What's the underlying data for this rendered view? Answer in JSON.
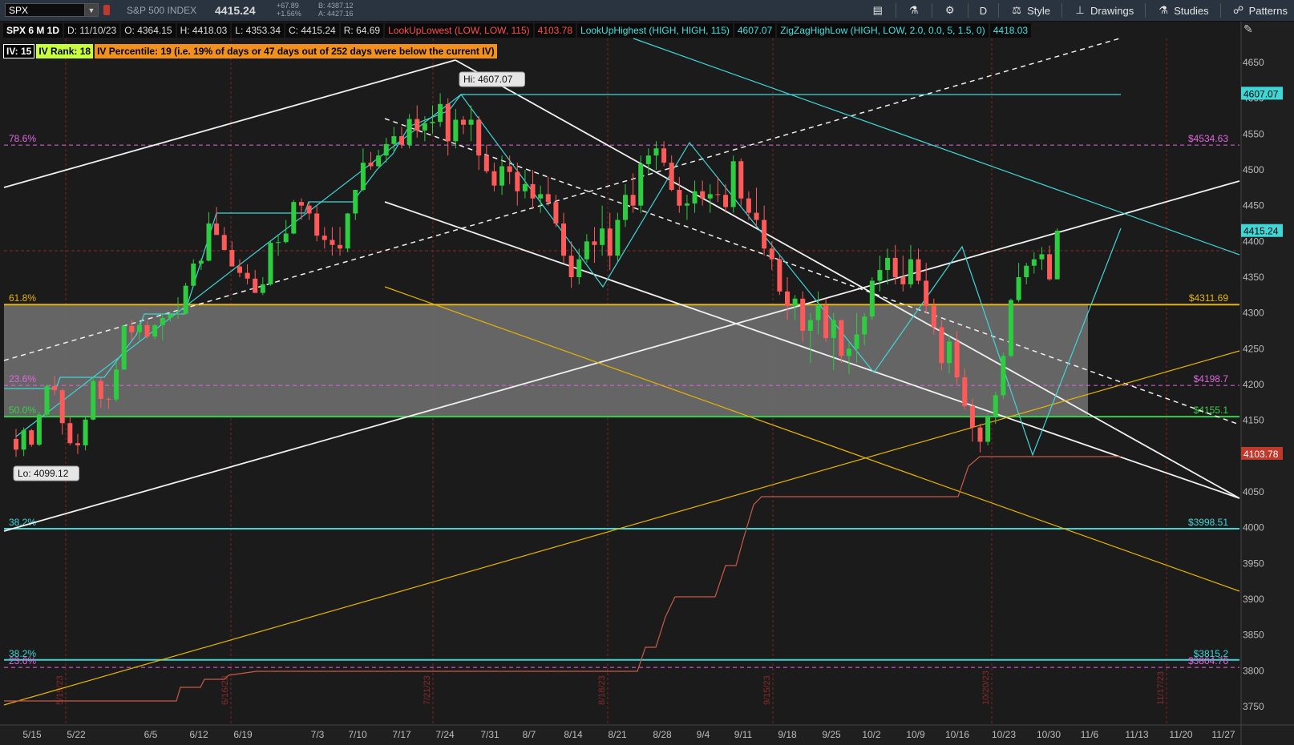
{
  "toolbar": {
    "symbol": "SPX",
    "name": "S&P 500 INDEX",
    "price": "4415.24",
    "change": "+67.89",
    "change_pct": "+1.56%",
    "bid": "B: 4387.12",
    "ask": "A: 4427.16",
    "period": "D",
    "style": "Style",
    "drawings": "Drawings",
    "studies": "Studies",
    "patterns": "Patterns"
  },
  "info": {
    "title": "SPX 6 M 1D",
    "date": "D: 11/10/23",
    "open": "O: 4364.15",
    "high": "H: 4418.03",
    "low": "L: 4353.34",
    "close": "C: 4415.24",
    "range": "R: 64.69",
    "study1": "LookUpLowest (LOW, LOW, 115)",
    "study1_val": "4103.78",
    "study2": "LookUpHighest (HIGH, HIGH, 115)",
    "study2_val": "4607.07",
    "study3": "ZigZagHighLow (HIGH, LOW, 2.0, 0.0, 5, 1.5, 0)",
    "study3_val": "4418.03"
  },
  "iv": {
    "iv": "IV: 15",
    "rank": "IV Rank: 18",
    "percentile": "IV Percentile: 19 (i.e. 19% of days or 47 days out of 252 days were below the current IV)"
  },
  "colors": {
    "up": "#2ecc40",
    "down": "#ff5a5a",
    "cyan": "#3fd6d6",
    "gold": "#e8b400",
    "green": "#36d14a",
    "magenta": "#e066e0",
    "white": "#f0f0f0",
    "lookup_low": "#c85a4a"
  },
  "chart_data": {
    "type": "candlestick",
    "title": "SPX 6 M 1D",
    "y_range": [
      3720,
      4680
    ],
    "y_ticks": [
      3750,
      3800,
      3850,
      3900,
      3950,
      4000,
      4050,
      4100,
      4150,
      4200,
      4250,
      4300,
      4350,
      4400,
      4450,
      4500,
      4550,
      4600,
      4650
    ],
    "x_ticks": [
      "5/15",
      "5/22",
      "6/5",
      "6/12",
      "6/19",
      "7/3",
      "7/10",
      "7/17",
      "7/24",
      "7/31",
      "8/7",
      "8/14",
      "8/21",
      "8/28",
      "9/4",
      "9/11",
      "9/18",
      "9/25",
      "10/2",
      "10/9",
      "10/16",
      "10/23",
      "10/30",
      "11/6",
      "11/13",
      "11/20",
      "11/27"
    ],
    "vertical_date_labels": [
      "5/19/23",
      "6/16/23",
      "7/21/23",
      "8/18/23",
      "9/15/23",
      "10/20/23",
      "11/17/23"
    ],
    "fib_levels": [
      {
        "label": "78.6%",
        "price": "$4534.63",
        "value": 4534.63
      },
      {
        "label": "61.8%",
        "price": "$4311.69",
        "value": 4311.69
      },
      {
        "label": "23.6%",
        "price": "$4198.7",
        "value": 4198.7
      },
      {
        "label": "50.0%",
        "price": "$4155.1",
        "value": 4155.1
      },
      {
        "label": "38.2%",
        "price": "$3998.51",
        "value": 3998.51
      },
      {
        "label": "38.2%",
        "price": "$3815.2",
        "value": 3815.2
      },
      {
        "label": "23.6%",
        "price": "$3804.76",
        "value": 3804.76
      }
    ],
    "price_tags": [
      {
        "text": "4607.07",
        "value": 4607.07
      },
      {
        "text": "4415.24",
        "value": 4415.24
      },
      {
        "text": "4103.78",
        "value": 4103.78
      }
    ],
    "bubbles": {
      "high": "Hi: 4607.07",
      "low": "Lo: 4099.12"
    },
    "candles": [
      [
        4124,
        4138,
        4099,
        4109
      ],
      [
        4109,
        4140,
        4100,
        4136
      ],
      [
        4136,
        4138,
        4113,
        4116
      ],
      [
        4116,
        4162,
        4114,
        4158
      ],
      [
        4158,
        4200,
        4155,
        4198
      ],
      [
        4198,
        4212,
        4185,
        4192
      ],
      [
        4192,
        4195,
        4130,
        4146
      ],
      [
        4146,
        4155,
        4115,
        4118
      ],
      [
        4118,
        4131,
        4103,
        4115
      ],
      [
        4115,
        4154,
        4108,
        4151
      ],
      [
        4151,
        4212,
        4150,
        4205
      ],
      [
        4205,
        4210,
        4167,
        4180
      ],
      [
        4180,
        4182,
        4166,
        4179
      ],
      [
        4179,
        4232,
        4176,
        4221
      ],
      [
        4221,
        4282,
        4220,
        4282
      ],
      [
        4282,
        4290,
        4262,
        4273
      ],
      [
        4273,
        4287,
        4262,
        4283
      ],
      [
        4283,
        4288,
        4264,
        4267
      ],
      [
        4267,
        4284,
        4263,
        4283
      ],
      [
        4283,
        4300,
        4262,
        4293
      ],
      [
        4293,
        4300,
        4288,
        4298
      ],
      [
        4298,
        4322,
        4292,
        4299
      ],
      [
        4299,
        4342,
        4298,
        4338
      ],
      [
        4338,
        4375,
        4337,
        4369
      ],
      [
        4369,
        4376,
        4360,
        4373
      ],
      [
        4373,
        4441,
        4372,
        4425
      ],
      [
        4425,
        4448,
        4420,
        4409
      ],
      [
        4409,
        4420,
        4390,
        4388
      ],
      [
        4388,
        4400,
        4375,
        4365
      ],
      [
        4365,
        4375,
        4350,
        4356
      ],
      [
        4356,
        4368,
        4340,
        4348
      ],
      [
        4348,
        4360,
        4330,
        4328
      ],
      [
        4328,
        4350,
        4325,
        4340
      ],
      [
        4340,
        4400,
        4338,
        4398
      ],
      [
        4398,
        4410,
        4380,
        4399
      ],
      [
        4399,
        4430,
        4397,
        4411
      ],
      [
        4411,
        4458,
        4410,
        4455
      ],
      [
        4455,
        4460,
        4430,
        4450
      ],
      [
        4450,
        4455,
        4430,
        4439
      ],
      [
        4439,
        4450,
        4400,
        4408
      ],
      [
        4408,
        4420,
        4390,
        4402
      ],
      [
        4402,
        4420,
        4380,
        4395
      ],
      [
        4395,
        4420,
        4380,
        4390
      ],
      [
        4390,
        4440,
        4385,
        4439
      ],
      [
        4439,
        4470,
        4430,
        4472
      ],
      [
        4472,
        4530,
        4470,
        4510
      ],
      [
        4510,
        4525,
        4500,
        4505
      ],
      [
        4505,
        4528,
        4504,
        4520
      ],
      [
        4520,
        4545,
        4510,
        4536
      ],
      [
        4536,
        4560,
        4525,
        4547
      ],
      [
        4547,
        4560,
        4530,
        4535
      ],
      [
        4535,
        4578,
        4530,
        4571
      ],
      [
        4571,
        4590,
        4545,
        4555
      ],
      [
        4555,
        4575,
        4540,
        4565
      ],
      [
        4565,
        4590,
        4550,
        4567
      ],
      [
        4567,
        4607,
        4560,
        4592
      ],
      [
        4592,
        4600,
        4520,
        4540
      ],
      [
        4540,
        4585,
        4530,
        4570
      ],
      [
        4570,
        4575,
        4550,
        4563
      ],
      [
        4563,
        4590,
        4540,
        4570
      ],
      [
        4570,
        4575,
        4500,
        4520
      ],
      [
        4520,
        4535,
        4495,
        4498
      ],
      [
        4498,
        4510,
        4470,
        4478
      ],
      [
        4478,
        4520,
        4465,
        4505
      ],
      [
        4505,
        4520,
        4480,
        4497
      ],
      [
        4497,
        4510,
        4450,
        4470
      ],
      [
        4470,
        4500,
        4460,
        4480
      ],
      [
        4480,
        4500,
        4445,
        4460
      ],
      [
        4460,
        4478,
        4440,
        4466
      ],
      [
        4466,
        4490,
        4450,
        4455
      ],
      [
        4455,
        4465,
        4420,
        4425
      ],
      [
        4425,
        4440,
        4370,
        4380
      ],
      [
        4380,
        4400,
        4335,
        4350
      ],
      [
        4350,
        4390,
        4340,
        4375
      ],
      [
        4375,
        4410,
        4370,
        4400
      ],
      [
        4400,
        4420,
        4370,
        4395
      ],
      [
        4395,
        4450,
        4380,
        4418
      ],
      [
        4418,
        4440,
        4360,
        4380
      ],
      [
        4380,
        4440,
        4372,
        4430
      ],
      [
        4430,
        4480,
        4420,
        4465
      ],
      [
        4465,
        4495,
        4440,
        4450
      ],
      [
        4450,
        4520,
        4440,
        4508
      ],
      [
        4508,
        4530,
        4495,
        4520
      ],
      [
        4520,
        4540,
        4500,
        4530
      ],
      [
        4530,
        4540,
        4505,
        4510
      ],
      [
        4510,
        4520,
        4470,
        4472
      ],
      [
        4472,
        4490,
        4440,
        4450
      ],
      [
        4450,
        4465,
        4430,
        4453
      ],
      [
        4453,
        4485,
        4440,
        4470
      ],
      [
        4470,
        4485,
        4450,
        4460
      ],
      [
        4460,
        4480,
        4440,
        4466
      ],
      [
        4466,
        4490,
        4455,
        4465
      ],
      [
        4465,
        4480,
        4440,
        4448
      ],
      [
        4448,
        4520,
        4440,
        4512
      ],
      [
        4512,
        4516,
        4450,
        4460
      ],
      [
        4460,
        4470,
        4430,
        4440
      ],
      [
        4440,
        4475,
        4420,
        4430
      ],
      [
        4430,
        4450,
        4380,
        4390
      ],
      [
        4390,
        4400,
        4360,
        4375
      ],
      [
        4375,
        4380,
        4325,
        4330
      ],
      [
        4330,
        4350,
        4290,
        4310
      ],
      [
        4310,
        4325,
        4290,
        4320
      ],
      [
        4320,
        4330,
        4260,
        4275
      ],
      [
        4275,
        4300,
        4230,
        4290
      ],
      [
        4290,
        4330,
        4270,
        4310
      ],
      [
        4310,
        4320,
        4260,
        4265
      ],
      [
        4265,
        4300,
        4220,
        4290
      ],
      [
        4290,
        4290,
        4230,
        4240
      ],
      [
        4240,
        4260,
        4215,
        4250
      ],
      [
        4250,
        4300,
        4230,
        4270
      ],
      [
        4270,
        4300,
        4255,
        4295
      ],
      [
        4295,
        4350,
        4290,
        4345
      ],
      [
        4345,
        4380,
        4330,
        4360
      ],
      [
        4360,
        4390,
        4340,
        4377
      ],
      [
        4377,
        4395,
        4340,
        4350
      ],
      [
        4350,
        4380,
        4330,
        4340
      ],
      [
        4340,
        4395,
        4335,
        4375
      ],
      [
        4375,
        4390,
        4340,
        4345
      ],
      [
        4345,
        4370,
        4300,
        4310
      ],
      [
        4310,
        4320,
        4270,
        4280
      ],
      [
        4280,
        4290,
        4220,
        4230
      ],
      [
        4230,
        4270,
        4215,
        4260
      ],
      [
        4260,
        4275,
        4200,
        4210
      ],
      [
        4210,
        4222,
        4165,
        4170
      ],
      [
        4170,
        4180,
        4120,
        4140
      ],
      [
        4140,
        4145,
        4105,
        4120
      ],
      [
        4120,
        4160,
        4115,
        4155
      ],
      [
        4155,
        4190,
        4145,
        4185
      ],
      [
        4185,
        4245,
        4180,
        4240
      ],
      [
        4240,
        4320,
        4238,
        4318
      ],
      [
        4318,
        4370,
        4315,
        4350
      ],
      [
        4350,
        4370,
        4340,
        4366
      ],
      [
        4366,
        4385,
        4355,
        4375
      ],
      [
        4375,
        4392,
        4360,
        4382
      ],
      [
        4382,
        4394,
        4345,
        4347
      ],
      [
        4347,
        4418,
        4353,
        4415
      ]
    ]
  }
}
